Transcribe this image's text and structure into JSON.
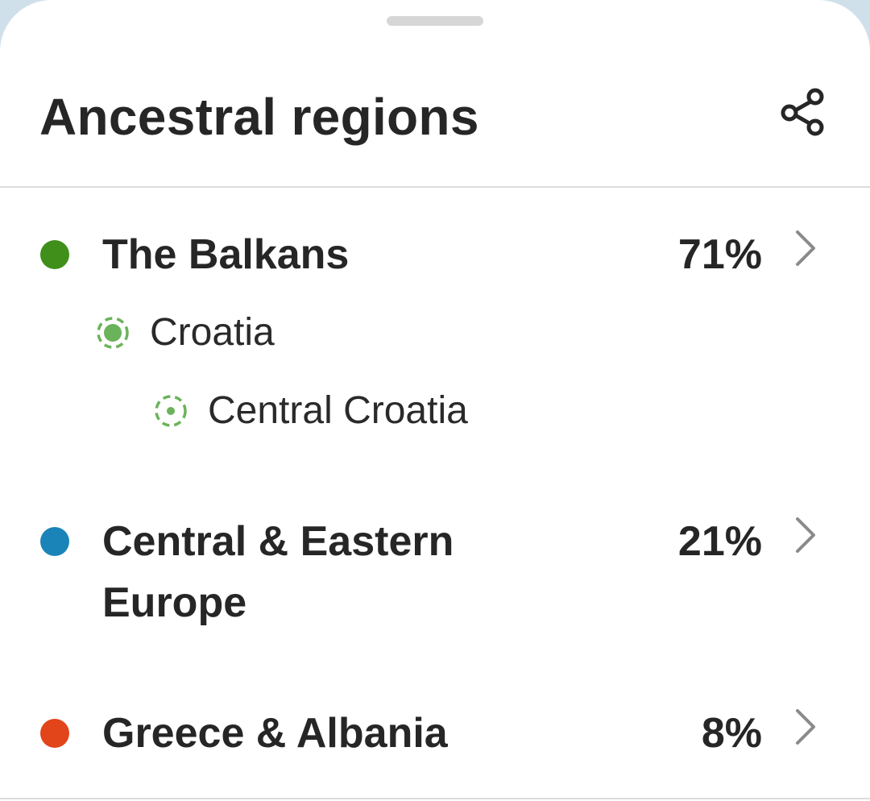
{
  "sheet": {
    "title": "Ancestral regions"
  },
  "icons": {
    "share": "share-icon",
    "chevron": "chevron-right-icon",
    "subregion": "dashed-location-ring-icon"
  },
  "regions": [
    {
      "name": "The Balkans",
      "percent": "71%",
      "color": "#3f8f1a",
      "subregions": [
        {
          "name": "Croatia",
          "level": 1
        },
        {
          "name": "Central Croatia",
          "level": 2
        }
      ]
    },
    {
      "name": "Central & Eastern Europe",
      "percent": "21%",
      "color": "#1a84b8",
      "subregions": []
    },
    {
      "name": "Greece & Albania",
      "percent": "8%",
      "color": "#e2451a",
      "subregions": []
    }
  ],
  "colors": {
    "subregion_accent": "#6bb35a",
    "chevron": "#8a8a8a",
    "text": "#262626",
    "divider": "#dcdcdc"
  }
}
